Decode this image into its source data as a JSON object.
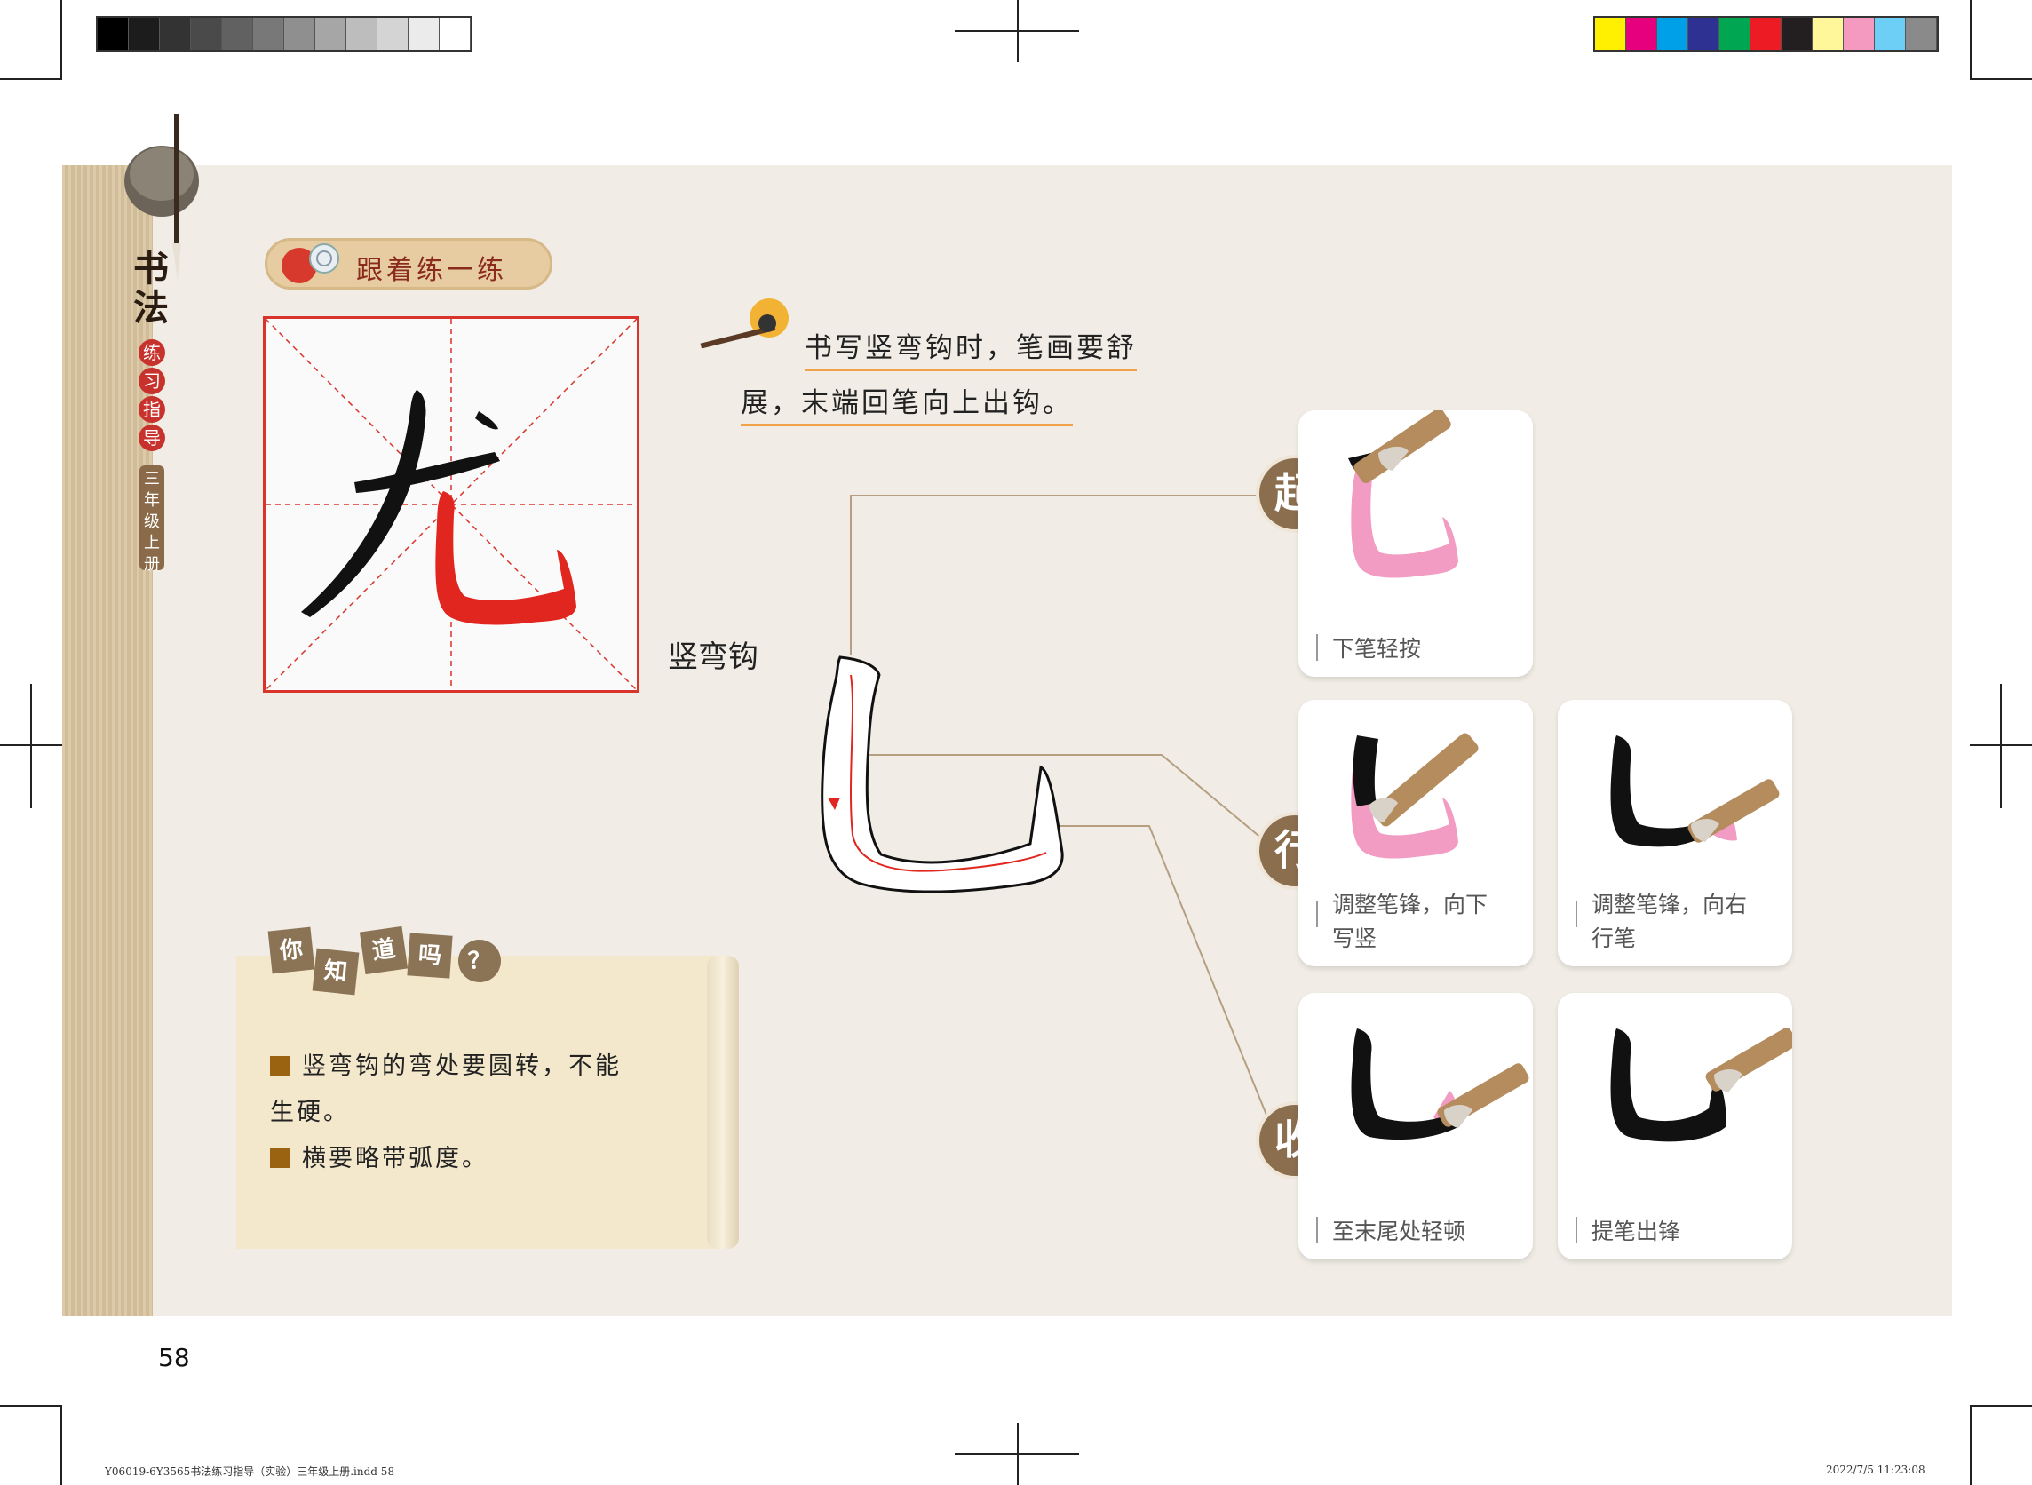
{
  "sidebar": {
    "title_chars": [
      "书",
      "法"
    ],
    "subtitle_chars": [
      "练",
      "习",
      "指",
      "导"
    ],
    "grade_chars": [
      "三",
      "年",
      "级",
      "上",
      "册"
    ]
  },
  "practice": {
    "label": "跟着练一练"
  },
  "example_char": {
    "black": "尢",
    "colors": {
      "black": "#111111",
      "red": "#e0261f"
    }
  },
  "tip": {
    "line1": "书写竖弯钩时，笔画要舒",
    "line2": "展，末端回笔向上出钩。"
  },
  "stroke_name": "竖弯钩",
  "stages": [
    {
      "badge": "起",
      "cards": [
        {
          "caption": [
            "下笔轻按"
          ]
        }
      ]
    },
    {
      "badge": "行",
      "cards": [
        {
          "caption": [
            "调整笔锋，向下",
            "写竖"
          ]
        },
        {
          "caption": [
            "调整笔锋，向右",
            "行笔"
          ]
        }
      ]
    },
    {
      "badge": "收",
      "cards": [
        {
          "caption": [
            "至末尾处轻顿"
          ]
        },
        {
          "caption": [
            "提笔出锋"
          ]
        }
      ]
    }
  ],
  "did_you_know": {
    "tags": [
      "你",
      "知",
      "道",
      "吗",
      "？"
    ],
    "bullets": [
      "竖弯钩的弯处要圆转，不能",
      "生硬。",
      "横要略带弧度。"
    ]
  },
  "page_number": "58",
  "footer": {
    "left": "Y06019-6Y3565书法练习指导（实验）三年级上册.indd   58",
    "right": "2022/7/5   11:23:08"
  },
  "colors": {
    "pink": "#f29cc4",
    "badge": "#8a6e4e",
    "accent_red": "#d9342b"
  }
}
